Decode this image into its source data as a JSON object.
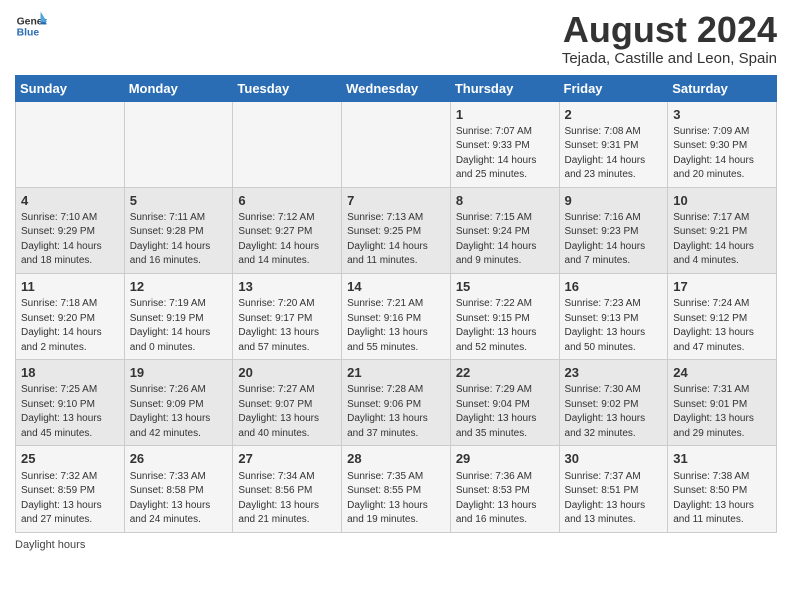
{
  "header": {
    "logo_line1": "General",
    "logo_line2": "Blue",
    "title": "August 2024",
    "subtitle": "Tejada, Castille and Leon, Spain"
  },
  "days_of_week": [
    "Sunday",
    "Monday",
    "Tuesday",
    "Wednesday",
    "Thursday",
    "Friday",
    "Saturday"
  ],
  "weeks": [
    [
      {
        "day": "",
        "info": ""
      },
      {
        "day": "",
        "info": ""
      },
      {
        "day": "",
        "info": ""
      },
      {
        "day": "",
        "info": ""
      },
      {
        "day": "1",
        "info": "Sunrise: 7:07 AM\nSunset: 9:33 PM\nDaylight: 14 hours and 25 minutes."
      },
      {
        "day": "2",
        "info": "Sunrise: 7:08 AM\nSunset: 9:31 PM\nDaylight: 14 hours and 23 minutes."
      },
      {
        "day": "3",
        "info": "Sunrise: 7:09 AM\nSunset: 9:30 PM\nDaylight: 14 hours and 20 minutes."
      }
    ],
    [
      {
        "day": "4",
        "info": "Sunrise: 7:10 AM\nSunset: 9:29 PM\nDaylight: 14 hours and 18 minutes."
      },
      {
        "day": "5",
        "info": "Sunrise: 7:11 AM\nSunset: 9:28 PM\nDaylight: 14 hours and 16 minutes."
      },
      {
        "day": "6",
        "info": "Sunrise: 7:12 AM\nSunset: 9:27 PM\nDaylight: 14 hours and 14 minutes."
      },
      {
        "day": "7",
        "info": "Sunrise: 7:13 AM\nSunset: 9:25 PM\nDaylight: 14 hours and 11 minutes."
      },
      {
        "day": "8",
        "info": "Sunrise: 7:15 AM\nSunset: 9:24 PM\nDaylight: 14 hours and 9 minutes."
      },
      {
        "day": "9",
        "info": "Sunrise: 7:16 AM\nSunset: 9:23 PM\nDaylight: 14 hours and 7 minutes."
      },
      {
        "day": "10",
        "info": "Sunrise: 7:17 AM\nSunset: 9:21 PM\nDaylight: 14 hours and 4 minutes."
      }
    ],
    [
      {
        "day": "11",
        "info": "Sunrise: 7:18 AM\nSunset: 9:20 PM\nDaylight: 14 hours and 2 minutes."
      },
      {
        "day": "12",
        "info": "Sunrise: 7:19 AM\nSunset: 9:19 PM\nDaylight: 14 hours and 0 minutes."
      },
      {
        "day": "13",
        "info": "Sunrise: 7:20 AM\nSunset: 9:17 PM\nDaylight: 13 hours and 57 minutes."
      },
      {
        "day": "14",
        "info": "Sunrise: 7:21 AM\nSunset: 9:16 PM\nDaylight: 13 hours and 55 minutes."
      },
      {
        "day": "15",
        "info": "Sunrise: 7:22 AM\nSunset: 9:15 PM\nDaylight: 13 hours and 52 minutes."
      },
      {
        "day": "16",
        "info": "Sunrise: 7:23 AM\nSunset: 9:13 PM\nDaylight: 13 hours and 50 minutes."
      },
      {
        "day": "17",
        "info": "Sunrise: 7:24 AM\nSunset: 9:12 PM\nDaylight: 13 hours and 47 minutes."
      }
    ],
    [
      {
        "day": "18",
        "info": "Sunrise: 7:25 AM\nSunset: 9:10 PM\nDaylight: 13 hours and 45 minutes."
      },
      {
        "day": "19",
        "info": "Sunrise: 7:26 AM\nSunset: 9:09 PM\nDaylight: 13 hours and 42 minutes."
      },
      {
        "day": "20",
        "info": "Sunrise: 7:27 AM\nSunset: 9:07 PM\nDaylight: 13 hours and 40 minutes."
      },
      {
        "day": "21",
        "info": "Sunrise: 7:28 AM\nSunset: 9:06 PM\nDaylight: 13 hours and 37 minutes."
      },
      {
        "day": "22",
        "info": "Sunrise: 7:29 AM\nSunset: 9:04 PM\nDaylight: 13 hours and 35 minutes."
      },
      {
        "day": "23",
        "info": "Sunrise: 7:30 AM\nSunset: 9:02 PM\nDaylight: 13 hours and 32 minutes."
      },
      {
        "day": "24",
        "info": "Sunrise: 7:31 AM\nSunset: 9:01 PM\nDaylight: 13 hours and 29 minutes."
      }
    ],
    [
      {
        "day": "25",
        "info": "Sunrise: 7:32 AM\nSunset: 8:59 PM\nDaylight: 13 hours and 27 minutes."
      },
      {
        "day": "26",
        "info": "Sunrise: 7:33 AM\nSunset: 8:58 PM\nDaylight: 13 hours and 24 minutes."
      },
      {
        "day": "27",
        "info": "Sunrise: 7:34 AM\nSunset: 8:56 PM\nDaylight: 13 hours and 21 minutes."
      },
      {
        "day": "28",
        "info": "Sunrise: 7:35 AM\nSunset: 8:55 PM\nDaylight: 13 hours and 19 minutes."
      },
      {
        "day": "29",
        "info": "Sunrise: 7:36 AM\nSunset: 8:53 PM\nDaylight: 13 hours and 16 minutes."
      },
      {
        "day": "30",
        "info": "Sunrise: 7:37 AM\nSunset: 8:51 PM\nDaylight: 13 hours and 13 minutes."
      },
      {
        "day": "31",
        "info": "Sunrise: 7:38 AM\nSunset: 8:50 PM\nDaylight: 13 hours and 11 minutes."
      }
    ]
  ],
  "footer": {
    "note": "Daylight hours"
  }
}
